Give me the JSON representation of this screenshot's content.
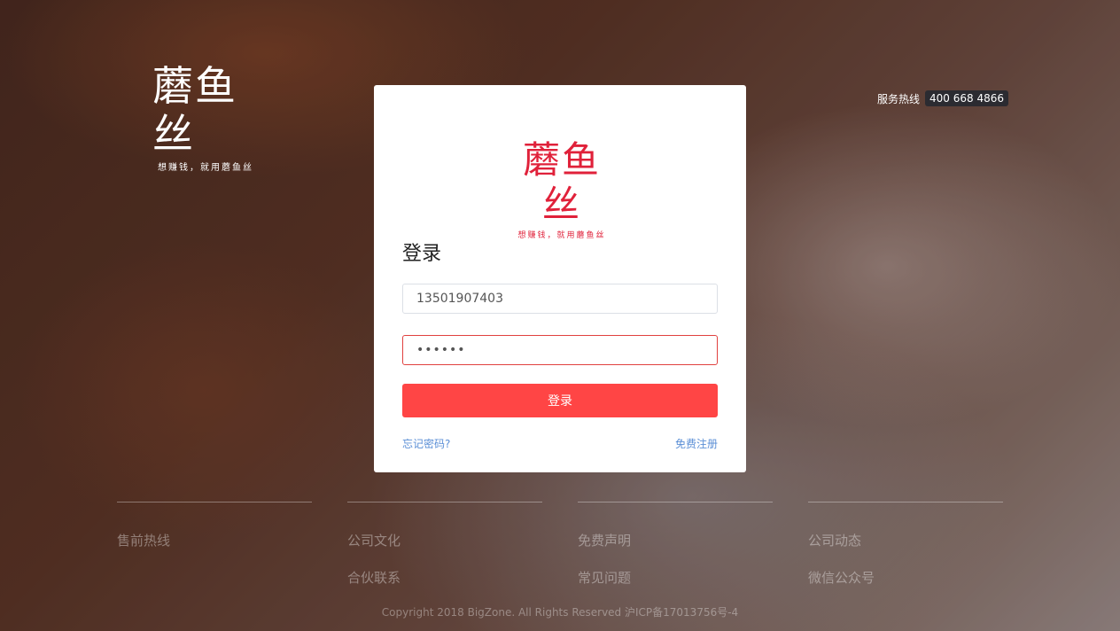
{
  "brand": {
    "logo_text": "蘑鱼丝",
    "tagline": "想赚钱，就用蘑鱼丝"
  },
  "header": {
    "hotline_label": "服务热线",
    "hotline_number": "400 668 4866"
  },
  "login": {
    "title": "登录",
    "phone_value": "13501907403",
    "password_value": "••••••",
    "submit_label": "登录",
    "forgot_label": "忘记密码?",
    "register_label": "免费注册"
  },
  "footer": {
    "columns": [
      {
        "links": [
          "售前热线"
        ]
      },
      {
        "links": [
          "公司文化",
          "合伙联系"
        ]
      },
      {
        "links": [
          "免费声明",
          "常见问题"
        ]
      },
      {
        "links": [
          "公司动态",
          "微信公众号"
        ]
      }
    ],
    "copyright": "Copyright 2018 BigZone. All Rights Reserved 沪ICP备17013756号-4"
  },
  "colors": {
    "accent": "#ff4545",
    "logo_red": "#e0213a",
    "link_blue": "#5b8fd6"
  }
}
